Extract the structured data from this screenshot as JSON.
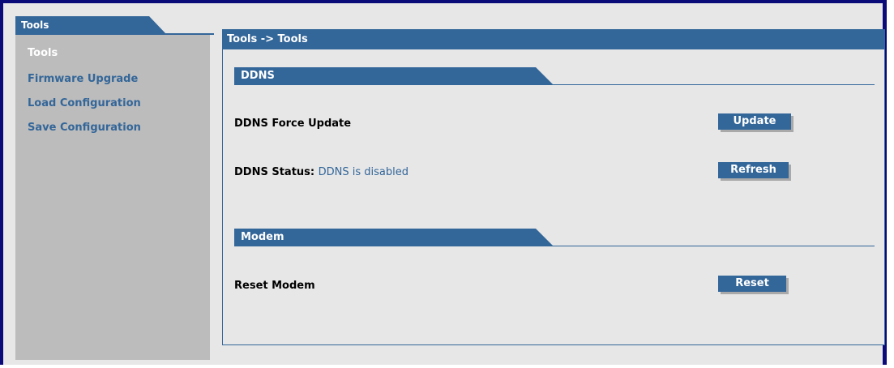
{
  "sidebar": {
    "tab_title": "Tools",
    "items": [
      {
        "label": "Tools",
        "active": true
      },
      {
        "label": "Firmware Upgrade",
        "active": false
      },
      {
        "label": "Load Configuration",
        "active": false
      },
      {
        "label": "Save Configuration",
        "active": false
      }
    ]
  },
  "panel": {
    "title": "Tools -> Tools"
  },
  "ddns": {
    "section_title": "DDNS",
    "force_update_label": "DDNS Force Update",
    "update_button": "Update",
    "status_label": "DDNS Status:",
    "status_value": "DDNS is disabled",
    "refresh_button": "Refresh"
  },
  "modem": {
    "section_title": "Modem",
    "reset_label": "Reset Modem",
    "reset_button": "Reset"
  },
  "colors": {
    "frame_border": "#0a0a78",
    "accent": "#336699",
    "background": "#e7e7e7",
    "sidebar_bg": "#bcbcbc"
  }
}
